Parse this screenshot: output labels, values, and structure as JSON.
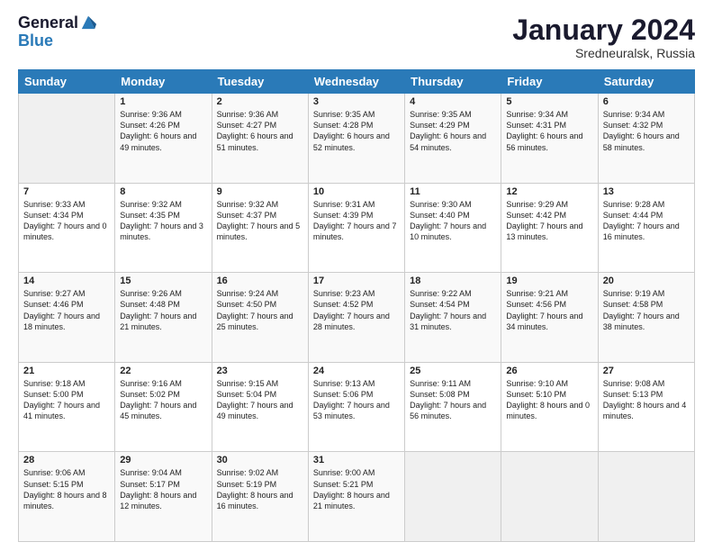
{
  "header": {
    "logo_general": "General",
    "logo_blue": "Blue",
    "month_title": "January 2024",
    "subtitle": "Sredneuralsk, Russia"
  },
  "weekdays": [
    "Sunday",
    "Monday",
    "Tuesday",
    "Wednesday",
    "Thursday",
    "Friday",
    "Saturday"
  ],
  "weeks": [
    [
      {
        "day": "",
        "sunrise": "",
        "sunset": "",
        "daylight": "",
        "empty": true
      },
      {
        "day": "1",
        "sunrise": "Sunrise: 9:36 AM",
        "sunset": "Sunset: 4:26 PM",
        "daylight": "Daylight: 6 hours and 49 minutes."
      },
      {
        "day": "2",
        "sunrise": "Sunrise: 9:36 AM",
        "sunset": "Sunset: 4:27 PM",
        "daylight": "Daylight: 6 hours and 51 minutes."
      },
      {
        "day": "3",
        "sunrise": "Sunrise: 9:35 AM",
        "sunset": "Sunset: 4:28 PM",
        "daylight": "Daylight: 6 hours and 52 minutes."
      },
      {
        "day": "4",
        "sunrise": "Sunrise: 9:35 AM",
        "sunset": "Sunset: 4:29 PM",
        "daylight": "Daylight: 6 hours and 54 minutes."
      },
      {
        "day": "5",
        "sunrise": "Sunrise: 9:34 AM",
        "sunset": "Sunset: 4:31 PM",
        "daylight": "Daylight: 6 hours and 56 minutes."
      },
      {
        "day": "6",
        "sunrise": "Sunrise: 9:34 AM",
        "sunset": "Sunset: 4:32 PM",
        "daylight": "Daylight: 6 hours and 58 minutes."
      }
    ],
    [
      {
        "day": "7",
        "sunrise": "Sunrise: 9:33 AM",
        "sunset": "Sunset: 4:34 PM",
        "daylight": "Daylight: 7 hours and 0 minutes."
      },
      {
        "day": "8",
        "sunrise": "Sunrise: 9:32 AM",
        "sunset": "Sunset: 4:35 PM",
        "daylight": "Daylight: 7 hours and 3 minutes."
      },
      {
        "day": "9",
        "sunrise": "Sunrise: 9:32 AM",
        "sunset": "Sunset: 4:37 PM",
        "daylight": "Daylight: 7 hours and 5 minutes."
      },
      {
        "day": "10",
        "sunrise": "Sunrise: 9:31 AM",
        "sunset": "Sunset: 4:39 PM",
        "daylight": "Daylight: 7 hours and 7 minutes."
      },
      {
        "day": "11",
        "sunrise": "Sunrise: 9:30 AM",
        "sunset": "Sunset: 4:40 PM",
        "daylight": "Daylight: 7 hours and 10 minutes."
      },
      {
        "day": "12",
        "sunrise": "Sunrise: 9:29 AM",
        "sunset": "Sunset: 4:42 PM",
        "daylight": "Daylight: 7 hours and 13 minutes."
      },
      {
        "day": "13",
        "sunrise": "Sunrise: 9:28 AM",
        "sunset": "Sunset: 4:44 PM",
        "daylight": "Daylight: 7 hours and 16 minutes."
      }
    ],
    [
      {
        "day": "14",
        "sunrise": "Sunrise: 9:27 AM",
        "sunset": "Sunset: 4:46 PM",
        "daylight": "Daylight: 7 hours and 18 minutes."
      },
      {
        "day": "15",
        "sunrise": "Sunrise: 9:26 AM",
        "sunset": "Sunset: 4:48 PM",
        "daylight": "Daylight: 7 hours and 21 minutes."
      },
      {
        "day": "16",
        "sunrise": "Sunrise: 9:24 AM",
        "sunset": "Sunset: 4:50 PM",
        "daylight": "Daylight: 7 hours and 25 minutes."
      },
      {
        "day": "17",
        "sunrise": "Sunrise: 9:23 AM",
        "sunset": "Sunset: 4:52 PM",
        "daylight": "Daylight: 7 hours and 28 minutes."
      },
      {
        "day": "18",
        "sunrise": "Sunrise: 9:22 AM",
        "sunset": "Sunset: 4:54 PM",
        "daylight": "Daylight: 7 hours and 31 minutes."
      },
      {
        "day": "19",
        "sunrise": "Sunrise: 9:21 AM",
        "sunset": "Sunset: 4:56 PM",
        "daylight": "Daylight: 7 hours and 34 minutes."
      },
      {
        "day": "20",
        "sunrise": "Sunrise: 9:19 AM",
        "sunset": "Sunset: 4:58 PM",
        "daylight": "Daylight: 7 hours and 38 minutes."
      }
    ],
    [
      {
        "day": "21",
        "sunrise": "Sunrise: 9:18 AM",
        "sunset": "Sunset: 5:00 PM",
        "daylight": "Daylight: 7 hours and 41 minutes."
      },
      {
        "day": "22",
        "sunrise": "Sunrise: 9:16 AM",
        "sunset": "Sunset: 5:02 PM",
        "daylight": "Daylight: 7 hours and 45 minutes."
      },
      {
        "day": "23",
        "sunrise": "Sunrise: 9:15 AM",
        "sunset": "Sunset: 5:04 PM",
        "daylight": "Daylight: 7 hours and 49 minutes."
      },
      {
        "day": "24",
        "sunrise": "Sunrise: 9:13 AM",
        "sunset": "Sunset: 5:06 PM",
        "daylight": "Daylight: 7 hours and 53 minutes."
      },
      {
        "day": "25",
        "sunrise": "Sunrise: 9:11 AM",
        "sunset": "Sunset: 5:08 PM",
        "daylight": "Daylight: 7 hours and 56 minutes."
      },
      {
        "day": "26",
        "sunrise": "Sunrise: 9:10 AM",
        "sunset": "Sunset: 5:10 PM",
        "daylight": "Daylight: 8 hours and 0 minutes."
      },
      {
        "day": "27",
        "sunrise": "Sunrise: 9:08 AM",
        "sunset": "Sunset: 5:13 PM",
        "daylight": "Daylight: 8 hours and 4 minutes."
      }
    ],
    [
      {
        "day": "28",
        "sunrise": "Sunrise: 9:06 AM",
        "sunset": "Sunset: 5:15 PM",
        "daylight": "Daylight: 8 hours and 8 minutes."
      },
      {
        "day": "29",
        "sunrise": "Sunrise: 9:04 AM",
        "sunset": "Sunset: 5:17 PM",
        "daylight": "Daylight: 8 hours and 12 minutes."
      },
      {
        "day": "30",
        "sunrise": "Sunrise: 9:02 AM",
        "sunset": "Sunset: 5:19 PM",
        "daylight": "Daylight: 8 hours and 16 minutes."
      },
      {
        "day": "31",
        "sunrise": "Sunrise: 9:00 AM",
        "sunset": "Sunset: 5:21 PM",
        "daylight": "Daylight: 8 hours and 21 minutes."
      },
      {
        "day": "",
        "sunrise": "",
        "sunset": "",
        "daylight": "",
        "empty": true
      },
      {
        "day": "",
        "sunrise": "",
        "sunset": "",
        "daylight": "",
        "empty": true
      },
      {
        "day": "",
        "sunrise": "",
        "sunset": "",
        "daylight": "",
        "empty": true
      }
    ]
  ]
}
